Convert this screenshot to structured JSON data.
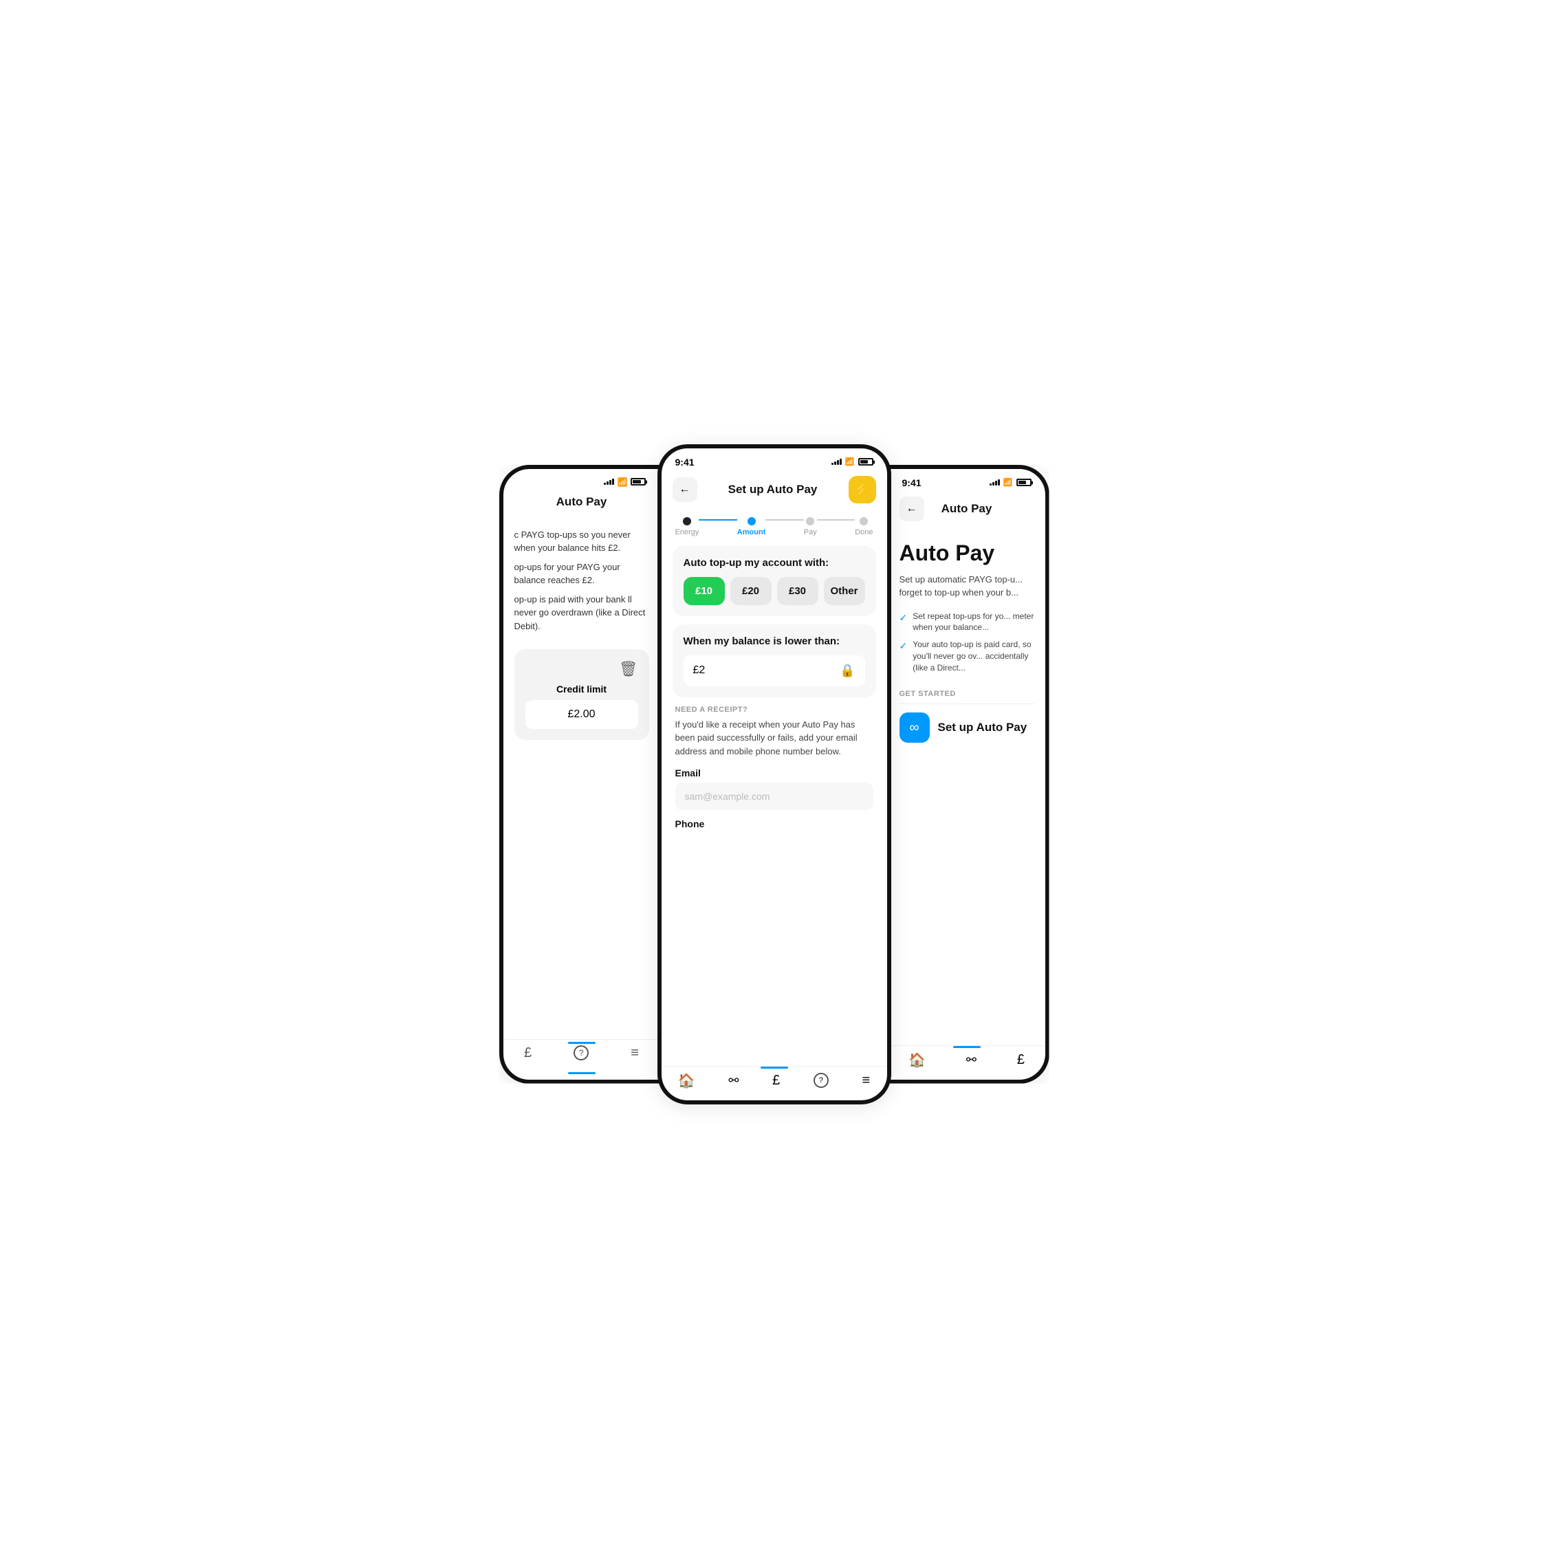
{
  "phones": {
    "left": {
      "status": {
        "signal_bars": [
          3,
          5,
          7,
          9,
          11
        ],
        "wifi": "wifi",
        "battery_level": 70
      },
      "header": {
        "title": "Auto Pay"
      },
      "content": {
        "desc1": "c PAYG top-ups so you never when your balance hits £2.",
        "desc2": "op-ups for your PAYG your balance reaches £2.",
        "desc3": "op-up is paid with your bank ll never go overdrawn (like a Direct Debit).",
        "credit_label": "Credit limit",
        "credit_value": "£2.00"
      },
      "nav": {
        "items": [
          "£",
          "?",
          "≡"
        ]
      }
    },
    "center": {
      "status": {
        "time": "9:41",
        "signal_bars": [
          3,
          5,
          7,
          9,
          11
        ],
        "wifi": "wifi",
        "battery_level": 70
      },
      "header": {
        "back_label": "←",
        "title": "Set up Auto Pay",
        "icon": "⚡"
      },
      "stepper": {
        "steps": [
          {
            "label": "Energy",
            "state": "done"
          },
          {
            "label": "Amount",
            "state": "active"
          },
          {
            "label": "Pay",
            "state": "upcoming"
          },
          {
            "label": "Done",
            "state": "upcoming"
          }
        ]
      },
      "top_up_card": {
        "title": "Auto top-up my account with:",
        "options": [
          {
            "label": "£10",
            "selected": true
          },
          {
            "label": "£20",
            "selected": false
          },
          {
            "label": "£30",
            "selected": false
          },
          {
            "label": "Other",
            "selected": false
          }
        ]
      },
      "balance_card": {
        "label": "When my balance is lower than:",
        "value": "£2"
      },
      "receipt": {
        "section_label": "NEED A RECEIPT?",
        "description": "If you'd like a receipt when your Auto Pay has been paid successfully or fails, add your email address and mobile phone number below.",
        "email_label": "Email",
        "email_placeholder": "sam@example.com",
        "phone_label": "Phone"
      },
      "nav": {
        "items": [
          "🏠",
          "⚯",
          "£",
          "?",
          "≡"
        ],
        "active_index": 2
      }
    },
    "right": {
      "status": {
        "time": "9:41",
        "signal_bars": [
          3,
          5,
          7,
          9,
          11
        ],
        "wifi": "wifi",
        "battery_level": 70
      },
      "header": {
        "back_label": "←",
        "title": "Auto Pay"
      },
      "content": {
        "big_title": "Auto Pay",
        "desc": "Set up automatic PAYG top-u... forget to top-up when your b...",
        "checks": [
          "Set repeat top-ups for yo... meter when your balance...",
          "Your auto top-up is paid card, so you'll never go ov... accidentally (like a Direct..."
        ],
        "get_started_label": "GET STARTED",
        "setup_btn_label": "Set up Auto Pay",
        "setup_btn_icon": "∞"
      },
      "nav": {
        "items": [
          "🏠",
          "⚯",
          "£"
        ]
      }
    }
  }
}
